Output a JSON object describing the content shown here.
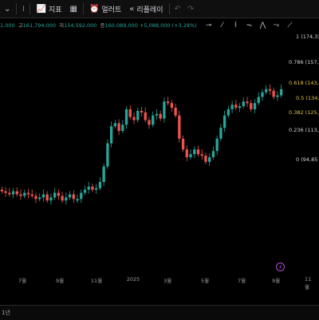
{
  "toolbar": {
    "indicator_label": "지표",
    "alert_label": "얼러트",
    "replay_label": "리플레이"
  },
  "ohlc": {
    "open_value": "1,000",
    "high_label": "고",
    "high_value": "161,794,000",
    "low_label": "저",
    "low_value": "154,592,000",
    "close_label": "종",
    "close_value": "160,089,000",
    "change": "+5,088,000 (+3.28%)"
  },
  "fib_levels": [
    {
      "ratio": "1",
      "price": "(174,33",
      "color": "#d1d4dc"
    },
    {
      "ratio": "0.786",
      "price": "(157,32",
      "color": "#d1d4dc"
    },
    {
      "ratio": "0.618",
      "price": "(143,97",
      "color": "#e0c341"
    },
    {
      "ratio": "0.5",
      "price": "(134,59",
      "color": "#e0c341"
    },
    {
      "ratio": "0.382",
      "price": "(125,21",
      "color": "#e0c341"
    },
    {
      "ratio": "0.236",
      "price": "(113,61",
      "color": "#d1d4dc"
    },
    {
      "ratio": "0",
      "price": "(94,85",
      "color": "#d1d4dc"
    }
  ],
  "x_axis": [
    "7월",
    "9월",
    "11월",
    "2025",
    "3월",
    "5월",
    "7월",
    "9월",
    "11월"
  ],
  "bottom_label": "1년",
  "colors": {
    "up": "#26a69a",
    "down": "#ef5350",
    "background": "#000000"
  },
  "chart_data": {
    "type": "candlestick",
    "x_ticks": [
      "7월",
      "9월",
      "11월",
      "2025",
      "3월",
      "5월",
      "7월",
      "9월",
      "11월"
    ],
    "price_axis_unit": "KRW",
    "fibonacci_retracement": [
      {
        "ratio": 1,
        "price_prefix": "174,33"
      },
      {
        "ratio": 0.786,
        "price_prefix": "157,32"
      },
      {
        "ratio": 0.618,
        "price_prefix": "143,97"
      },
      {
        "ratio": 0.5,
        "price_prefix": "134,59"
      },
      {
        "ratio": 0.382,
        "price_prefix": "125,21"
      },
      {
        "ratio": 0.236,
        "price_prefix": "113,61"
      },
      {
        "ratio": 0,
        "price_prefix": "94,85"
      }
    ],
    "candle_closes_approx_million_krw": [
      94,
      93,
      92,
      94,
      92,
      91,
      93,
      92,
      91,
      89,
      90,
      92,
      88,
      90,
      93,
      91,
      88,
      90,
      92,
      89,
      89,
      93,
      95,
      97,
      95,
      96,
      100,
      110,
      125,
      136,
      138,
      133,
      137,
      147,
      142,
      140,
      146,
      145,
      140,
      137,
      143,
      144,
      141,
      152,
      151,
      148,
      143,
      128,
      121,
      116,
      118,
      121,
      118,
      117,
      113,
      116,
      120,
      128,
      135,
      143,
      147,
      150,
      148,
      149,
      152,
      151,
      147,
      151,
      155,
      158,
      160,
      159,
      155,
      156,
      160
    ]
  }
}
